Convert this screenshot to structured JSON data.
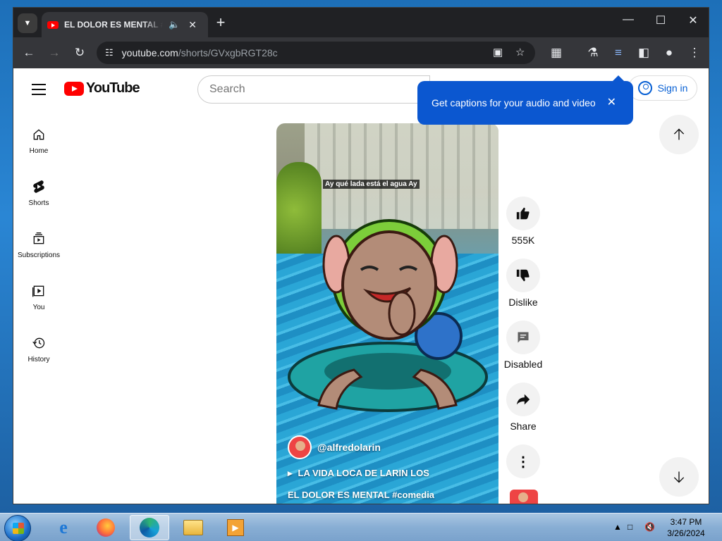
{
  "browser": {
    "tab_title": "EL DOLOR ES MENTAL #comedia",
    "url_host": "youtube.com",
    "url_path": "/shorts/GVxgbRGT28c"
  },
  "youtube": {
    "logo_text": "YouTube",
    "search_placeholder": "Search",
    "sign_in": "Sign in",
    "callout_text": "Get captions for your audio and video",
    "guide": [
      "Home",
      "Shorts",
      "Subscriptions",
      "You",
      "History"
    ],
    "video": {
      "caption": "Ay qué lada está el agua Ay",
      "channel": "@alfredolarin",
      "song": "LA VIDA LOCA DE LARIN LOS",
      "title": "EL DOLOR ES MENTAL #comedia"
    },
    "actions": {
      "like_count": "555K",
      "dislike_label": "Dislike",
      "comments_label": "Disabled",
      "share_label": "Share"
    }
  },
  "taskbar": {
    "time": "3:47 PM",
    "date": "3/26/2024"
  },
  "colors": {
    "brand_red": "#ff0000",
    "callout_blue": "#0b57d0",
    "link_blue": "#065fd4"
  }
}
